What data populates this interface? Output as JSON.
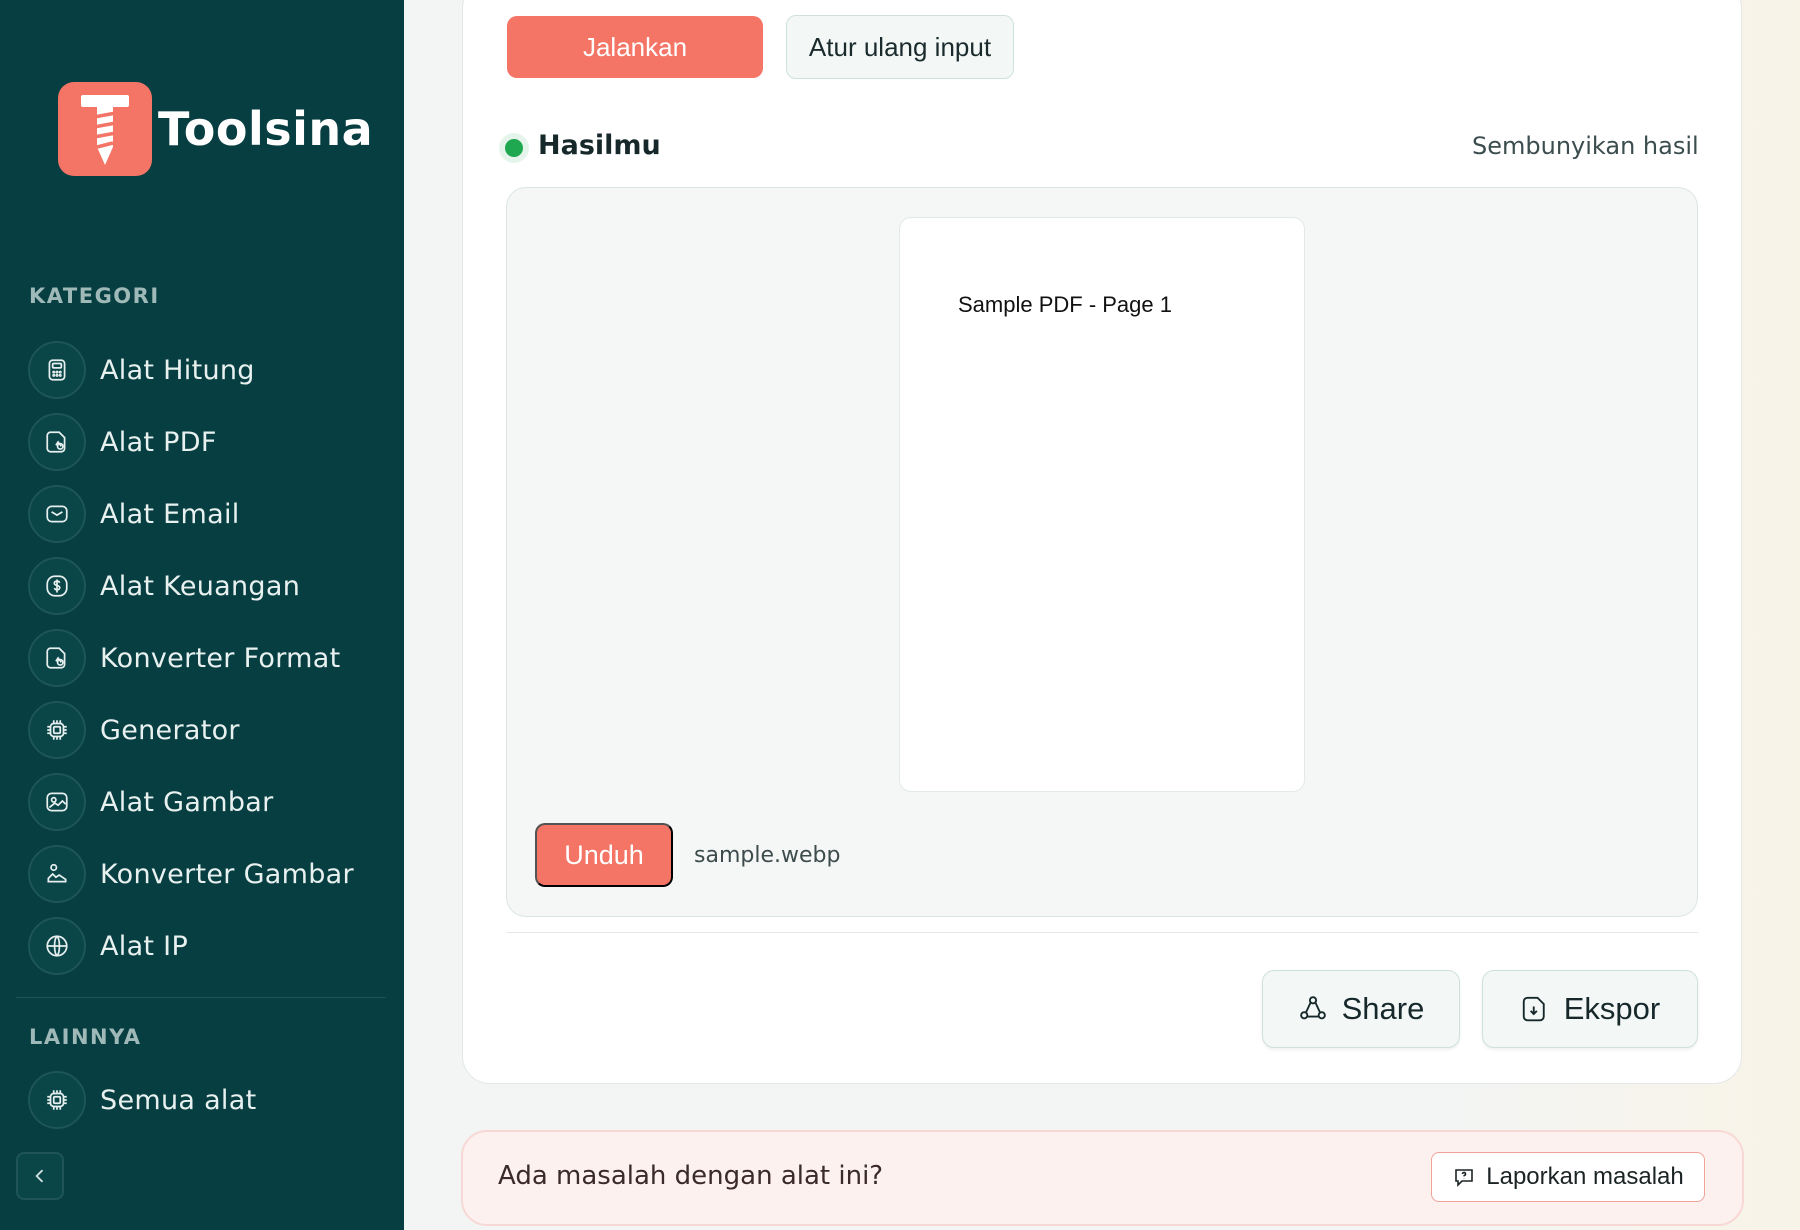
{
  "brand": {
    "name": "Toolsina",
    "accent": "#f47466",
    "sidebar_bg": "#073e41"
  },
  "sidebar": {
    "category_heading": "KATEGORI",
    "items": [
      {
        "label": "Alat Hitung",
        "icon": "calculator-icon"
      },
      {
        "label": "Alat PDF",
        "icon": "document-icon"
      },
      {
        "label": "Alat Email",
        "icon": "mail-icon"
      },
      {
        "label": "Alat Keuangan",
        "icon": "dollar-icon"
      },
      {
        "label": "Konverter Format",
        "icon": "document-icon"
      },
      {
        "label": "Generator",
        "icon": "chip-icon"
      },
      {
        "label": "Alat Gambar",
        "icon": "image-icon"
      },
      {
        "label": "Konverter Gambar",
        "icon": "image-person-icon"
      },
      {
        "label": "Alat IP",
        "icon": "globe-icon"
      }
    ],
    "other_heading": "LAINNYA",
    "other_items": [
      {
        "label": "Semua alat",
        "icon": "chip-icon"
      }
    ]
  },
  "toolbar": {
    "run_label": "Jalankan",
    "reset_label": "Atur ulang input"
  },
  "result": {
    "title": "Hasilmu",
    "hide_label": "Sembunyikan hasil",
    "preview_text": "Sample PDF - Page 1",
    "download_label": "Unduh",
    "filename": "sample.webp",
    "status_color": "#1fa84f"
  },
  "actions": {
    "share_label": "Share",
    "export_label": "Ekspor"
  },
  "feedback": {
    "question": "Ada masalah dengan alat ini?",
    "report_label": "Laporkan masalah"
  }
}
